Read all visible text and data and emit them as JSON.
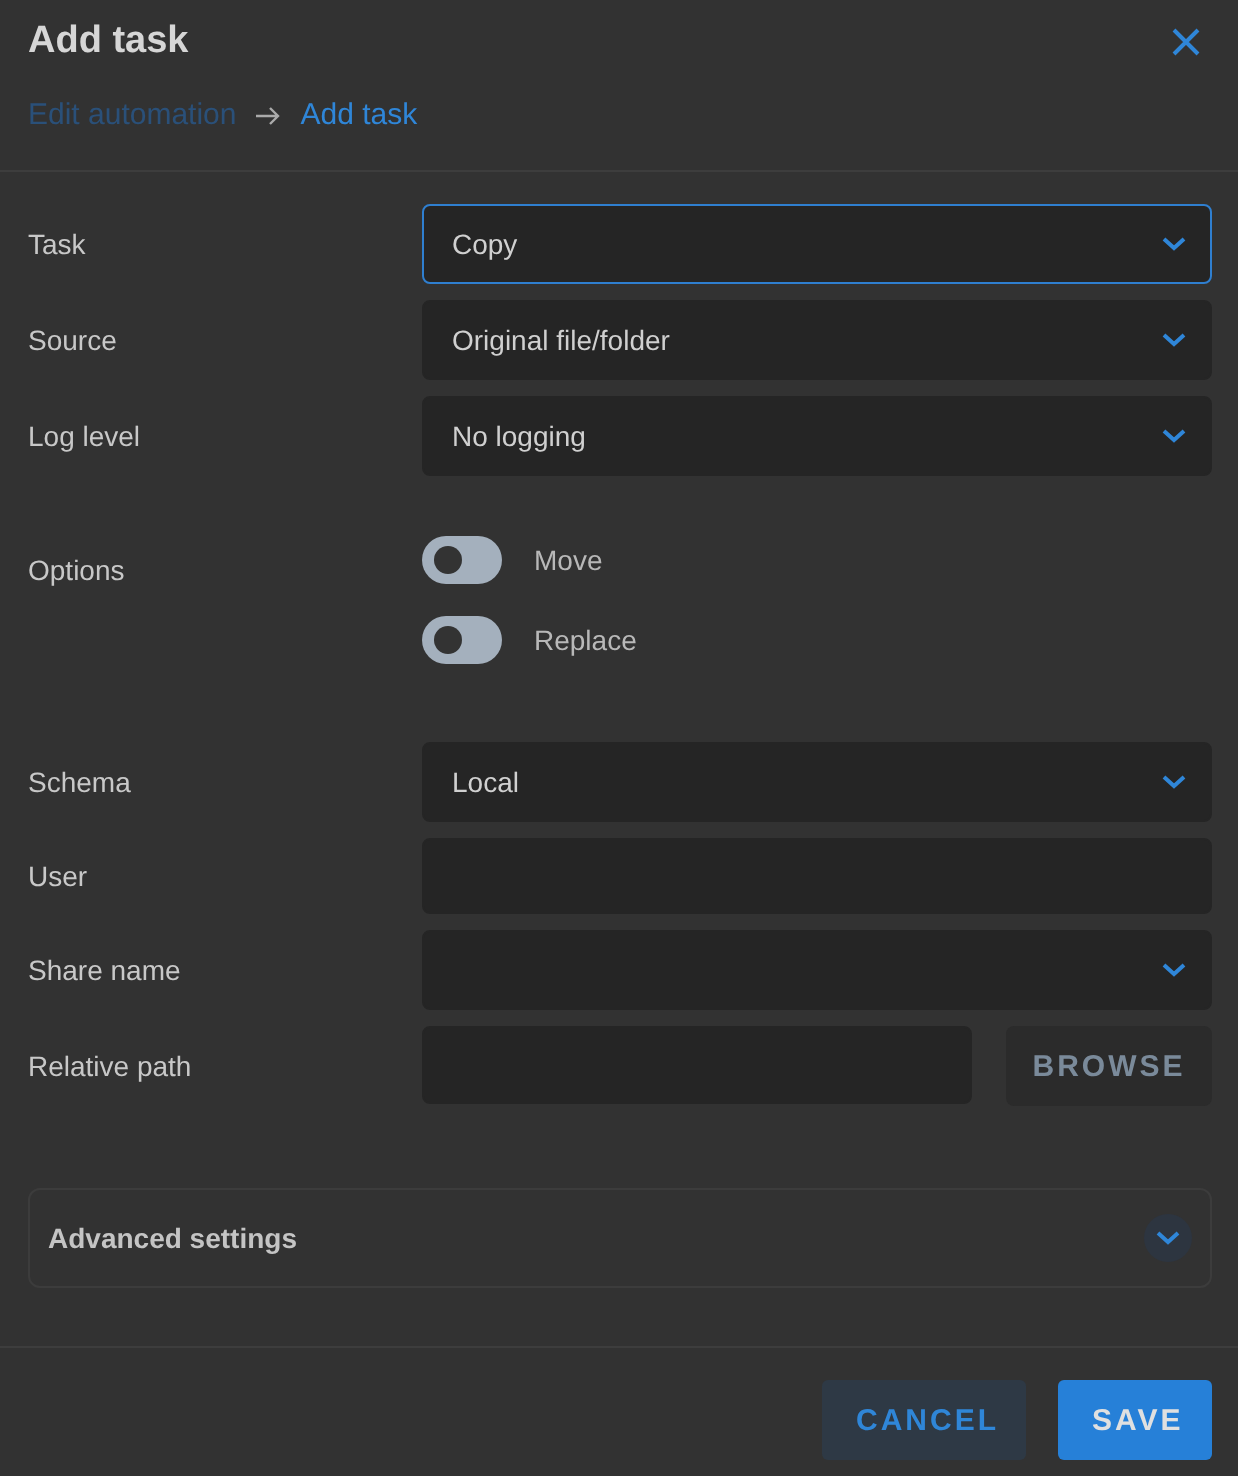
{
  "dialog": {
    "title": "Add task"
  },
  "breadcrumb": [
    {
      "label": "Edit automation",
      "selected": false
    },
    {
      "label": "Add task",
      "selected": true
    }
  ],
  "fields": [
    {
      "kind": "select",
      "label": "Task",
      "value": "Copy",
      "focused": true
    },
    {
      "kind": "select",
      "label": "Source",
      "value": "Original file/folder",
      "focused": false
    },
    {
      "kind": "select",
      "label": "Log level",
      "value": "No logging",
      "focused": false
    },
    {
      "kind": "toggles",
      "label": "Options",
      "toggles": [
        {
          "label": "Move",
          "on": false
        },
        {
          "label": "Replace",
          "on": false
        }
      ]
    },
    {
      "kind": "select",
      "label": "Schema",
      "value": "Local",
      "focused": false
    },
    {
      "kind": "text",
      "label": "User",
      "focused": false
    },
    {
      "kind": "select",
      "label": "Share name",
      "focused": false
    },
    {
      "kind": "path",
      "label": "Relative path",
      "button": "BROWSE",
      "focused": false
    }
  ],
  "advanced": {
    "label": "Advanced settings",
    "expanded": false
  },
  "buttons": [
    {
      "label": "CANCEL",
      "kind": "secondary"
    },
    {
      "label": "SAVE",
      "kind": "primary"
    }
  ]
}
